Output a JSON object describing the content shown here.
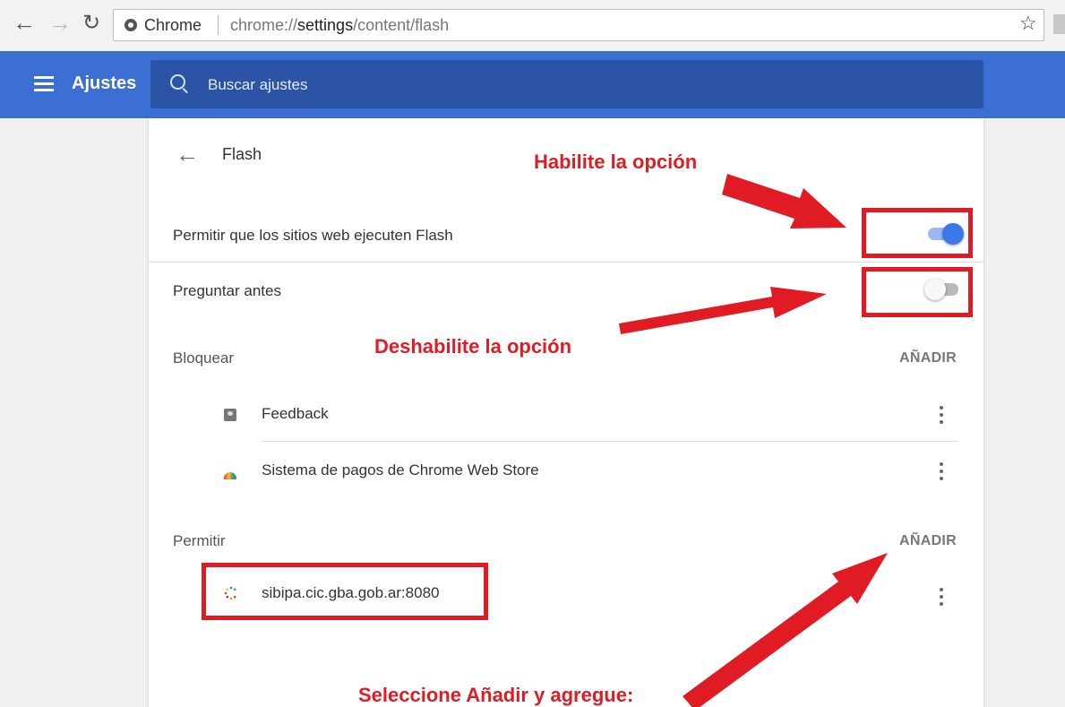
{
  "browser": {
    "origin_chip": "Chrome",
    "url_prefix": "chrome://",
    "url_host": "settings",
    "url_path": "/content/flash"
  },
  "header": {
    "title": "Ajustes",
    "search_placeholder": "Buscar ajustes"
  },
  "page": {
    "title": "Flash",
    "settings": [
      {
        "label": "Permitir que los sitios web ejecuten Flash",
        "enabled": true
      },
      {
        "label": "Preguntar antes",
        "enabled": false
      }
    ],
    "block_section": {
      "label": "Bloquear",
      "add_label": "AÑADIR",
      "sites": [
        {
          "label": "Feedback",
          "icon": "feedback-icon"
        },
        {
          "label": "Sistema de pagos de Chrome Web Store",
          "icon": "chrome-web-store-icon"
        }
      ]
    },
    "allow_section": {
      "label": "Permitir",
      "add_label": "AÑADIR",
      "sites": [
        {
          "label": "sibipa.cic.gba.gob.ar:8080",
          "icon": "site-favicon-icon"
        }
      ]
    }
  },
  "annotations": {
    "enable": "Habilite la opción",
    "disable": "Deshabilite la opción",
    "add": "Seleccione Añadir y agregue:",
    "color": "#e01b24"
  },
  "colors": {
    "header": "#3b6fd4",
    "search_box": "#2c54a6",
    "toggle_on": "#3b78e7"
  }
}
